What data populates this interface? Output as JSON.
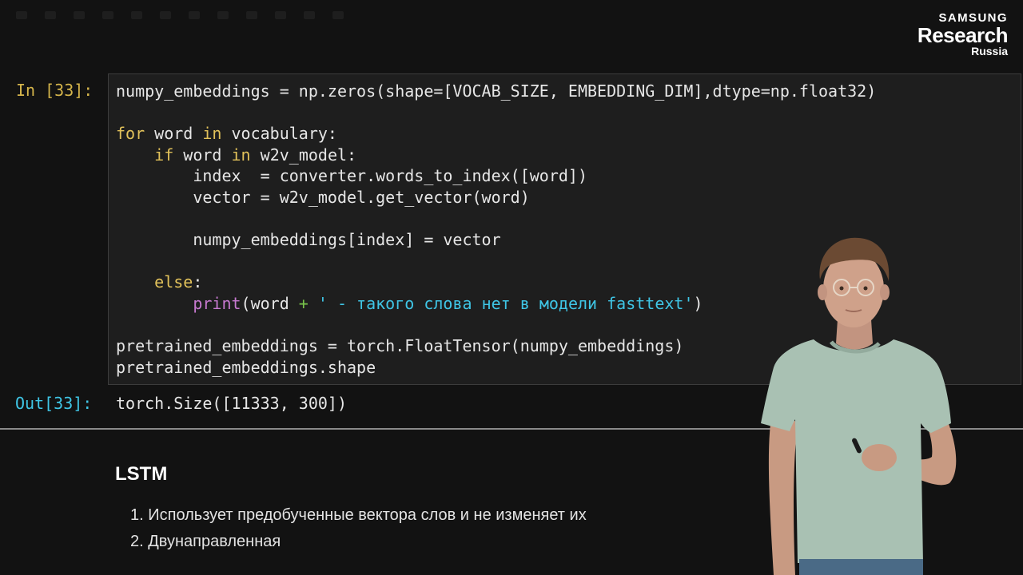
{
  "logo": {
    "line1": "SAMSUNG",
    "line2": "Research",
    "line3": "Russia"
  },
  "cell": {
    "in_prompt": "In [33]:",
    "out_prompt": "Out[33]:",
    "output": "torch.Size([11333, 300])"
  },
  "code": {
    "l1_a": "numpy_embeddings",
    "l1_b": " = np.zeros(shape=[VOCAB_SIZE, EMBEDDING_DIM],dtype=np.float32)",
    "l3_kw1": "for",
    "l3_a": " word ",
    "l3_kw2": "in",
    "l3_b": " vocabulary:",
    "l4_kw1": "if",
    "l4_a": " word ",
    "l4_kw2": "in",
    "l4_b": " w2v_model:",
    "l5": "index  = converter.words_to_index([word])",
    "l6": "vector = w2v_model.get_vector(word)",
    "l8": "numpy_embeddings[index] = vector",
    "l10_kw": "else",
    "l10_b": ":",
    "l11_fn": "print",
    "l11_a": "(word ",
    "l11_op": "+",
    "l11_str": " ' - такого слова нет в модели fasttext'",
    "l11_b": ")",
    "l13": "pretrained_embeddings = torch.FloatTensor(numpy_embeddings)",
    "l14": "pretrained_embeddings.shape"
  },
  "markdown": {
    "title": "LSTM",
    "items": [
      "1. Использует предобученные вектора слов и не изменяет их",
      "2. Двунаправленная"
    ]
  },
  "colors": {
    "keyword": "#e1c15a",
    "operator": "#79c54b",
    "builtin": "#c779d0",
    "string": "#3fc6e6",
    "in_prompt": "#d5b54b",
    "out_prompt": "#3fc6e6"
  }
}
